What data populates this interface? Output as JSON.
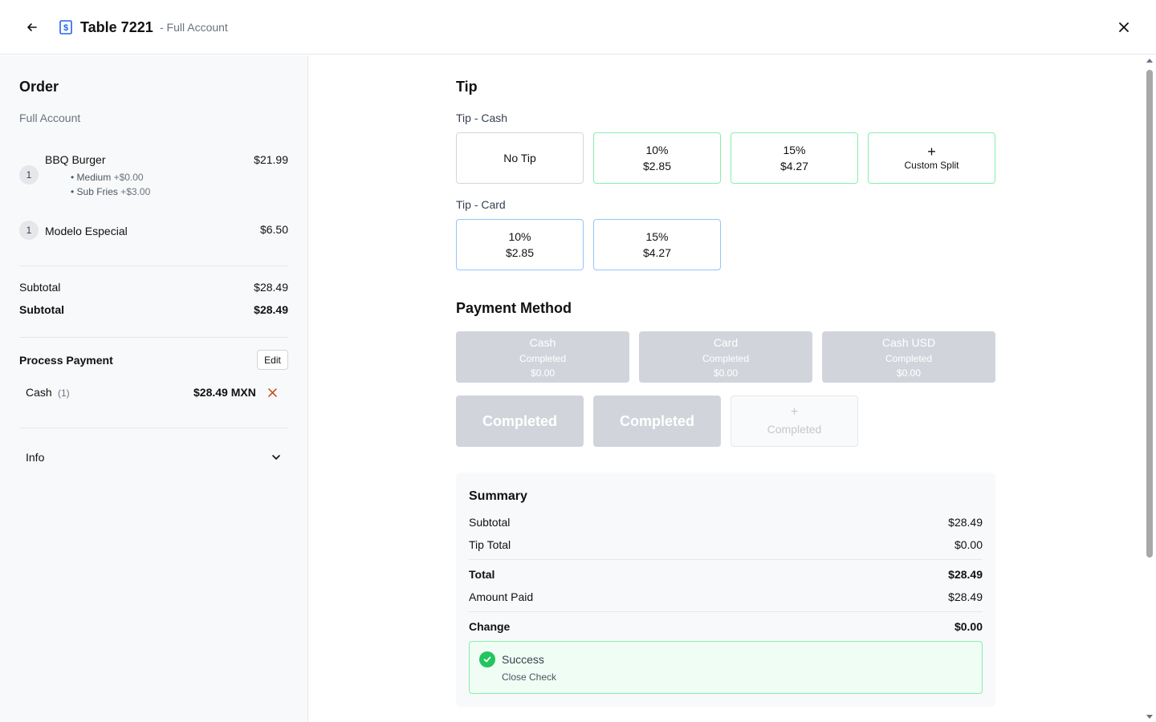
{
  "header": {
    "title": "Table 7221",
    "subtitle": "- Full Account",
    "icons": {
      "back": "arrow-left-icon",
      "bill": "dollar-bill-icon",
      "close": "close-icon"
    }
  },
  "order": {
    "title": "Order",
    "account": "Full Account",
    "items": [
      {
        "qty": "1",
        "name": "BBQ Burger",
        "price": "$21.99",
        "modifiers": [
          {
            "name": "• Medium",
            "price": "+$0.00"
          },
          {
            "name": "• Sub Fries",
            "price": "+$3.00"
          }
        ]
      },
      {
        "qty": "1",
        "name": "Modelo Especial",
        "price": "$6.50",
        "modifiers": []
      }
    ],
    "subtotals": [
      {
        "label": "Subtotal",
        "value": "$28.49"
      },
      {
        "label": "Subtotal",
        "value": "$28.49"
      }
    ]
  },
  "process_payment": {
    "title": "Process Payment",
    "edit_label": "Edit",
    "payments": [
      {
        "method": "Cash",
        "count": "(1)",
        "amount": "$28.49 MXN"
      }
    ]
  },
  "info": {
    "label": "Info"
  },
  "tip": {
    "title": "Tip",
    "cash_label": "Tip - Cash",
    "cash_options": [
      {
        "line1": "No Tip",
        "line2": ""
      },
      {
        "line1": "10%",
        "line2": "$2.85"
      },
      {
        "line1": "15%",
        "line2": "$4.27"
      },
      {
        "line1": "+",
        "line2": "Custom Split"
      }
    ],
    "card_label": "Tip - Card",
    "card_options": [
      {
        "line1": "10%",
        "line2": "$2.85"
      },
      {
        "line1": "15%",
        "line2": "$4.27"
      }
    ]
  },
  "payment_method": {
    "title": "Payment Method",
    "methods": [
      {
        "name": "Cash",
        "status": "Completed",
        "amount": "$0.00"
      },
      {
        "name": "Card",
        "status": "Completed",
        "amount": "$0.00"
      },
      {
        "name": "Cash USD",
        "status": "Completed",
        "amount": "$0.00"
      }
    ],
    "completed_buttons": [
      "Completed",
      "Completed"
    ],
    "add_button": {
      "icon": "+",
      "label": "Completed"
    }
  },
  "summary": {
    "title": "Summary",
    "subtotal": {
      "label": "Subtotal",
      "value": "$28.49"
    },
    "tip_total": {
      "label": "Tip Total",
      "value": "$0.00"
    },
    "total": {
      "label": "Total",
      "value": "$28.49"
    },
    "amount_paid": {
      "label": "Amount Paid",
      "value": "$28.49"
    },
    "change": {
      "label": "Change",
      "value": "$0.00"
    },
    "success": {
      "title": "Success",
      "action": "Close Check"
    }
  },
  "colors": {
    "accent_green": "#22c55e",
    "green_border": "#86efac",
    "blue_border": "#93c5fd",
    "disabled_gray": "#d1d5db",
    "remove_orange": "#c2410c",
    "icon_blue": "#2563eb"
  }
}
